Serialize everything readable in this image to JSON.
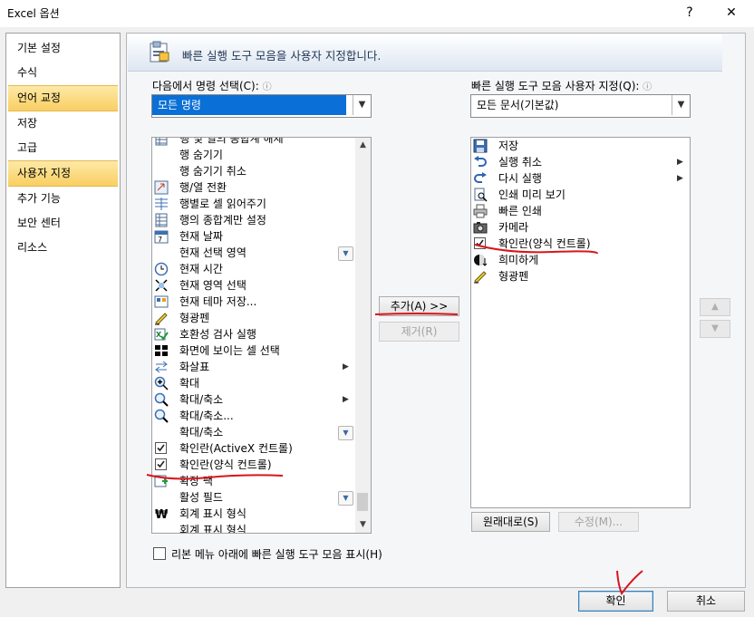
{
  "window": {
    "title": "Excel 옵션",
    "help": "?",
    "close": "✕"
  },
  "nav": {
    "items": [
      {
        "label": "기본 설정"
      },
      {
        "label": "수식"
      },
      {
        "label": "언어 교정"
      },
      {
        "label": "저장"
      },
      {
        "label": "고급"
      },
      {
        "label": "사용자 지정"
      },
      {
        "label": "추가 기능"
      },
      {
        "label": "보안 센터"
      },
      {
        "label": "리소스"
      }
    ],
    "selected": "사용자 지정",
    "highlighted": "언어 교정"
  },
  "header": {
    "title": "빠른 실행 도구 모음을 사용자 지정합니다."
  },
  "left": {
    "label": "다음에서 명령 선택(C):",
    "info": "ⓘ",
    "combo_value": "모든 명령",
    "items": [
      {
        "label": "행 및 열의 종합계 해제",
        "icon": "grid-icon"
      },
      {
        "label": "행 숨기기",
        "icon": ""
      },
      {
        "label": "행 숨기기 취소",
        "icon": ""
      },
      {
        "label": "행/열 전환",
        "icon": "switch-icon"
      },
      {
        "label": "행별로 셀 읽어주기",
        "icon": "rows-icon"
      },
      {
        "label": "행의 종합계만 설정",
        "icon": "grid-icon"
      },
      {
        "label": "현재 날짜",
        "icon": "calendar-icon"
      },
      {
        "label": "현재 선택 영역",
        "icon": "",
        "dropdown": true
      },
      {
        "label": "현재 시간",
        "icon": "clock-icon"
      },
      {
        "label": "현재 영역 선택",
        "icon": "select-region-icon"
      },
      {
        "label": "현재 테마 저장...",
        "icon": "theme-save-icon"
      },
      {
        "label": "형광펜",
        "icon": "highlighter-icon"
      },
      {
        "label": "호환성 검사 실행",
        "icon": "compat-check-icon"
      },
      {
        "label": "화면에 보이는 셀 선택",
        "icon": "visible-cells-icon"
      },
      {
        "label": "화살표",
        "icon": "arrows-icon",
        "submenu": true
      },
      {
        "label": "확대",
        "icon": "zoom-in-icon"
      },
      {
        "label": "확대/축소",
        "icon": "magnifier-icon",
        "submenu": true
      },
      {
        "label": "확대/축소...",
        "icon": "magnifier-icon"
      },
      {
        "label": "확대/축소",
        "icon": "",
        "dropdown": true
      },
      {
        "label": "확인란(ActiveX 컨트롤)",
        "icon": "checkbox-icon"
      },
      {
        "label": "확인란(양식 컨트롤)",
        "icon": "checkbox-icon"
      },
      {
        "label": "확장 팩",
        "icon": "expansion-pack-icon"
      },
      {
        "label": "활성 필드",
        "icon": "",
        "dropdown": true
      },
      {
        "label": "회계 표시 형식",
        "icon": "won-icon"
      },
      {
        "label": "회계 표시 형식",
        "icon": "dots-icon"
      }
    ]
  },
  "middle": {
    "add": "추가(A) >>",
    "remove": "제거(R)"
  },
  "right": {
    "label": "빠른 실행 도구 모음 사용자 지정(Q):",
    "info": "ⓘ",
    "combo_value": "모든 문서(기본값)",
    "items": [
      {
        "label": "저장",
        "icon": "save-icon"
      },
      {
        "label": "실행 취소",
        "icon": "undo-icon",
        "submenu": true
      },
      {
        "label": "다시 실행",
        "icon": "redo-icon",
        "submenu": true
      },
      {
        "label": "인쇄 미리 보기",
        "icon": "print-preview-icon"
      },
      {
        "label": "빠른 인쇄",
        "icon": "quick-print-icon"
      },
      {
        "label": "카메라",
        "icon": "camera-icon"
      },
      {
        "label": "확인란(양식 컨트롤)",
        "icon": "checkbox-icon"
      },
      {
        "label": "희미하게",
        "icon": "dim-icon"
      },
      {
        "label": "형광펜",
        "icon": "highlighter-icon"
      }
    ],
    "reset": "원래대로(S)",
    "modify": "수정(M)..."
  },
  "options": {
    "show_below_ribbon": "리본 메뉴 아래에 빠른 실행 도구 모음 표시(H)"
  },
  "footer": {
    "ok": "확인",
    "cancel": "취소"
  },
  "colors": {
    "annotation_red": "#d9151b",
    "selection_blue": "#0a6fd6",
    "nav_highlight": "#f9cf62"
  }
}
